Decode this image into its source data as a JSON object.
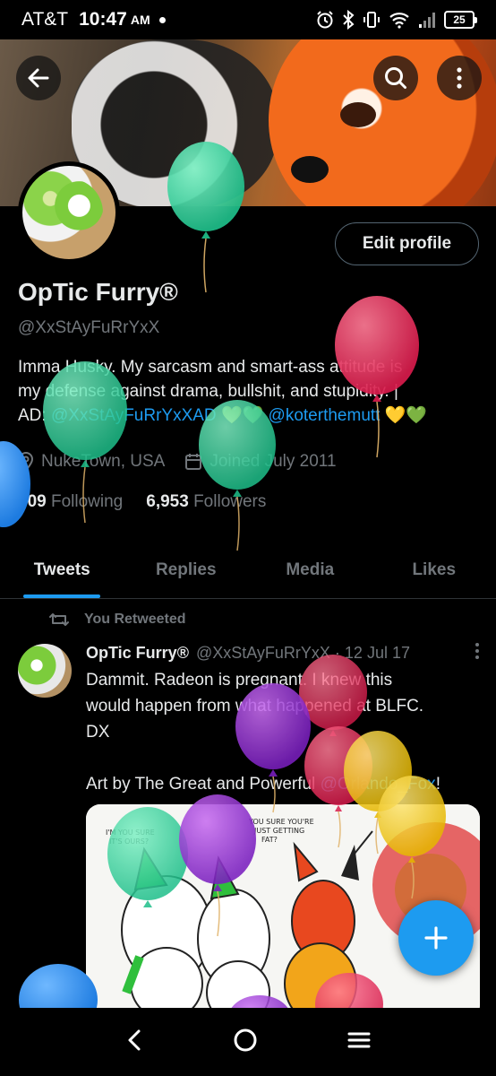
{
  "status_bar": {
    "carrier": "AT&T",
    "time": "10:47",
    "ampm": "AM",
    "battery": "25"
  },
  "header": {
    "back_icon": "arrow-left-icon",
    "search_icon": "search-icon",
    "more_icon": "more-vertical-icon"
  },
  "profile": {
    "edit_label": "Edit profile",
    "name": "OpTic Furry®",
    "handle": "@XxStAyFuRrYxX",
    "bio_line1": "Imma Husky. My sarcasm and smart-ass attitude is",
    "bio_line2": "my defense against drama, bullshit, and stupidity. |",
    "bio_ad": "AD: ",
    "bio_link1": "@XxStAyFuRrYxXAD",
    "bio_hearts1": "💛💚",
    "bio_link2": "@koterthemutt",
    "bio_hearts2": "💛💚",
    "location": "NukeTown, USA",
    "joined": "Joined July 2011",
    "following_count": "309",
    "following_label": "Following",
    "followers_count": "6,953",
    "followers_label": "Followers"
  },
  "tabs": [
    {
      "label": "Tweets",
      "active": true
    },
    {
      "label": "Replies",
      "active": false
    },
    {
      "label": "Media",
      "active": false
    },
    {
      "label": "Likes",
      "active": false
    }
  ],
  "tweet": {
    "retweet_label": "You Retweeted",
    "name": "OpTic Furry®",
    "handle_date": "@XxStAyFuRrYxX · 12 Jul 17",
    "text": "Dammit. Radeon is pregnant. I knew this\nwould happen from what happened at BLFC.\nDX\n\nArt by The Great and Powerful ",
    "text_link": "@Orlando_Fox",
    "text_end": "!",
    "image_text1": "I'M YOU SURE\nIT'S OURS?",
    "image_text2": "YOU SURE YOU'RE\nJUST GETTING\nFAT?"
  },
  "fab_icon": "plus-icon",
  "navbar": {
    "back_icon": "nav-back-icon",
    "home_icon": "nav-home-icon",
    "menu_icon": "nav-menu-icon"
  },
  "colors": {
    "accent": "#1d9bf0",
    "muted": "#71767b",
    "text": "#e7e9ea",
    "border": "#2f3336"
  }
}
